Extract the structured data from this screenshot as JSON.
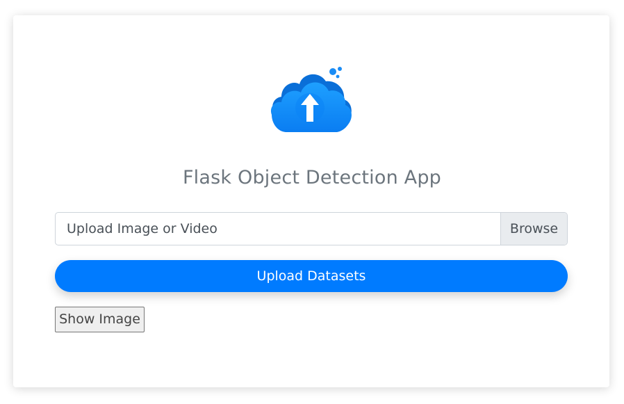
{
  "app": {
    "title": "Flask Object Detection App",
    "logo_icon": "cloud-upload-icon",
    "accent_color": "#007bff"
  },
  "upload_form": {
    "file_placeholder": "Upload Image or Video",
    "browse_label": "Browse",
    "submit_label": "Upload Datasets"
  },
  "actions": {
    "show_image_label": "Show Image"
  }
}
